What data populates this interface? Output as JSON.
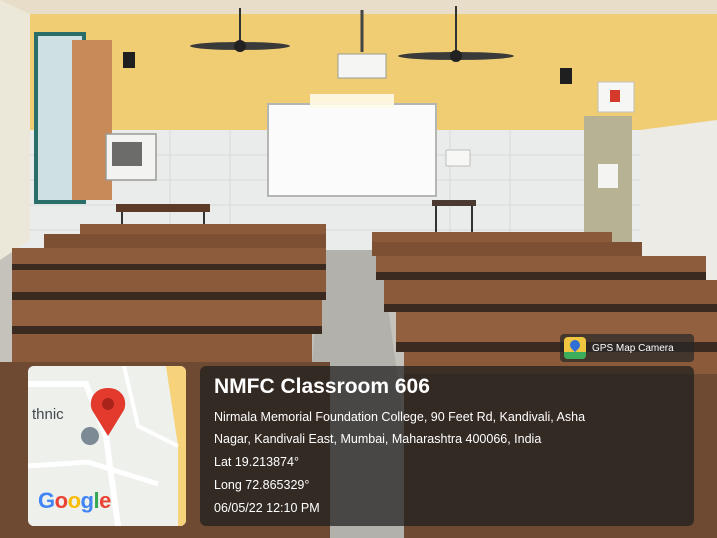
{
  "photo": {
    "description_colors": {
      "wall_yellow": "#f2cd6c",
      "tile_white": "#eef0ee",
      "desk_wood": "#8a5a3a",
      "floor": "#c9c8c2"
    }
  },
  "gps_badge": {
    "label": "GPS Map Camera",
    "icon": "gps-map-camera-icon"
  },
  "map": {
    "place_fragment": "thnic",
    "logo": "Google",
    "marker_icon": "map-pin-icon"
  },
  "location": {
    "title": "NMFC Classroom 606",
    "address_line1": "Nirmala Memorial Foundation College, 90 Feet Rd, Kandivali, Asha",
    "address_line2": "Nagar, Kandivali East, Mumbai, Maharashtra 400066, India",
    "latitude": "Lat 19.213874°",
    "longitude": "Long 72.865329°",
    "timestamp": "06/05/22 12:10 PM"
  }
}
